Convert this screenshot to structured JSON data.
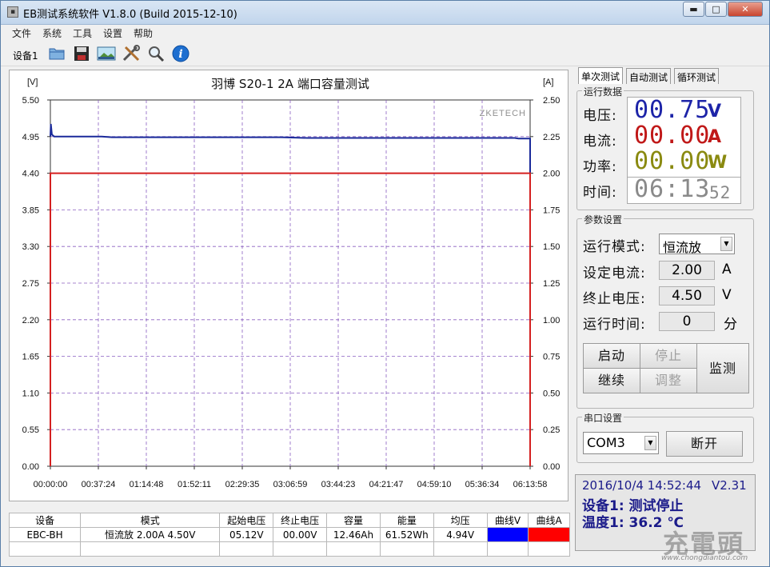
{
  "window": {
    "title": "EB测试系统软件 V1.8.0 (Build 2015-12-10)",
    "minimize": "▬",
    "maximize": "□",
    "close": "✕"
  },
  "menu": [
    "文件",
    "系统",
    "工具",
    "设置",
    "帮助"
  ],
  "toolbar": {
    "device_label": "设备1",
    "buttons": [
      "open-folder-icon",
      "save-icon",
      "image-icon",
      "tools-icon",
      "search-icon",
      "info-icon"
    ]
  },
  "chart_data": {
    "type": "line",
    "title": "羽博 S20-1 2A 端口容量测试",
    "watermark": "ZKETECH",
    "y_left_unit": "[V]",
    "y_right_unit": "[A]",
    "y_left_ticks": [
      "5.50",
      "4.95",
      "4.40",
      "3.85",
      "3.30",
      "2.75",
      "2.20",
      "1.65",
      "1.10",
      "0.55",
      "0.00"
    ],
    "y_right_ticks": [
      "2.50",
      "2.25",
      "2.00",
      "1.75",
      "1.50",
      "1.25",
      "1.00",
      "0.75",
      "0.50",
      "0.25",
      "0.00"
    ],
    "x_ticks": [
      "00:00:00",
      "00:37:24",
      "01:14:48",
      "01:52:11",
      "02:29:35",
      "03:06:59",
      "03:44:23",
      "04:21:47",
      "04:59:10",
      "05:36:34",
      "06:13:58"
    ],
    "ylim_left": [
      0,
      5.5
    ],
    "ylim_right": [
      0,
      2.5
    ],
    "xlim_minutes": [
      0,
      373.97
    ],
    "grid": true,
    "series": [
      {
        "axis": "left",
        "color": "#1a2a9a",
        "x_minutes": [
          0,
          0.4,
          1.2,
          3,
          10,
          40,
          48,
          60,
          120,
          180,
          200,
          240,
          300,
          350,
          362,
          365,
          373,
          373.97,
          373.97
        ],
        "values": [
          4.95,
          5.14,
          4.98,
          4.95,
          4.95,
          4.95,
          4.94,
          4.94,
          4.94,
          4.94,
          4.93,
          4.93,
          4.93,
          4.93,
          4.93,
          4.92,
          4.92,
          4.92,
          0
        ]
      },
      {
        "axis": "right",
        "color": "#d42020",
        "x_minutes": [
          0,
          0.01,
          373.97,
          373.97
        ],
        "values": [
          0,
          2.0,
          2.0,
          0
        ]
      }
    ]
  },
  "table": {
    "headers": [
      "设备",
      "模式",
      "起始电压",
      "终止电压",
      "容量",
      "能量",
      "均压",
      "曲线V",
      "曲线A"
    ],
    "row": [
      "EBC-BH",
      "恒流放  2.00A  4.50V",
      "05.12V",
      "00.00V",
      "12.46Ah",
      "61.52Wh",
      "4.94V"
    ],
    "curve_colors": [
      "#0000ff",
      "#ff0000"
    ]
  },
  "tabs": [
    "单次测试",
    "自动测试",
    "循环测试"
  ],
  "run_data": {
    "title": "运行数据",
    "voltage": {
      "label": "电压:",
      "value": "00.75",
      "unit": "V",
      "color": "#1d24a8"
    },
    "current": {
      "label": "电流:",
      "value": "00.00",
      "unit": "A",
      "color": "#c01818"
    },
    "power": {
      "label": "功率:",
      "value": "00.00",
      "unit": "W",
      "color": "#8a8a10"
    },
    "time": {
      "label": "时间:",
      "value": "06:13",
      "seconds": "52",
      "color": "#8a8a8a"
    }
  },
  "params": {
    "title": "参数设置",
    "mode_label": "运行模式:",
    "mode_value": "恒流放",
    "current_label": "设定电流:",
    "current_value": "2.00",
    "current_unit": "A",
    "cutoff_label": "终止电压:",
    "cutoff_value": "4.50",
    "cutoff_unit": "V",
    "runtime_label": "运行时间:",
    "runtime_value": "0",
    "runtime_unit": "分",
    "start": "启动",
    "stop": "停止",
    "continue": "继续",
    "adjust": "调整",
    "monitor": "监测"
  },
  "serial": {
    "title": "串口设置",
    "port": "COM3",
    "disconnect": "断开"
  },
  "status": {
    "datetime": "2016/10/4 14:52:44",
    "version": "V2.31",
    "device_status": "设备1: 测试停止",
    "temperature": "温度1: 36.2 ℃"
  },
  "watermark": {
    "text": "充電頭",
    "url": "www.chongdiantou.com"
  }
}
